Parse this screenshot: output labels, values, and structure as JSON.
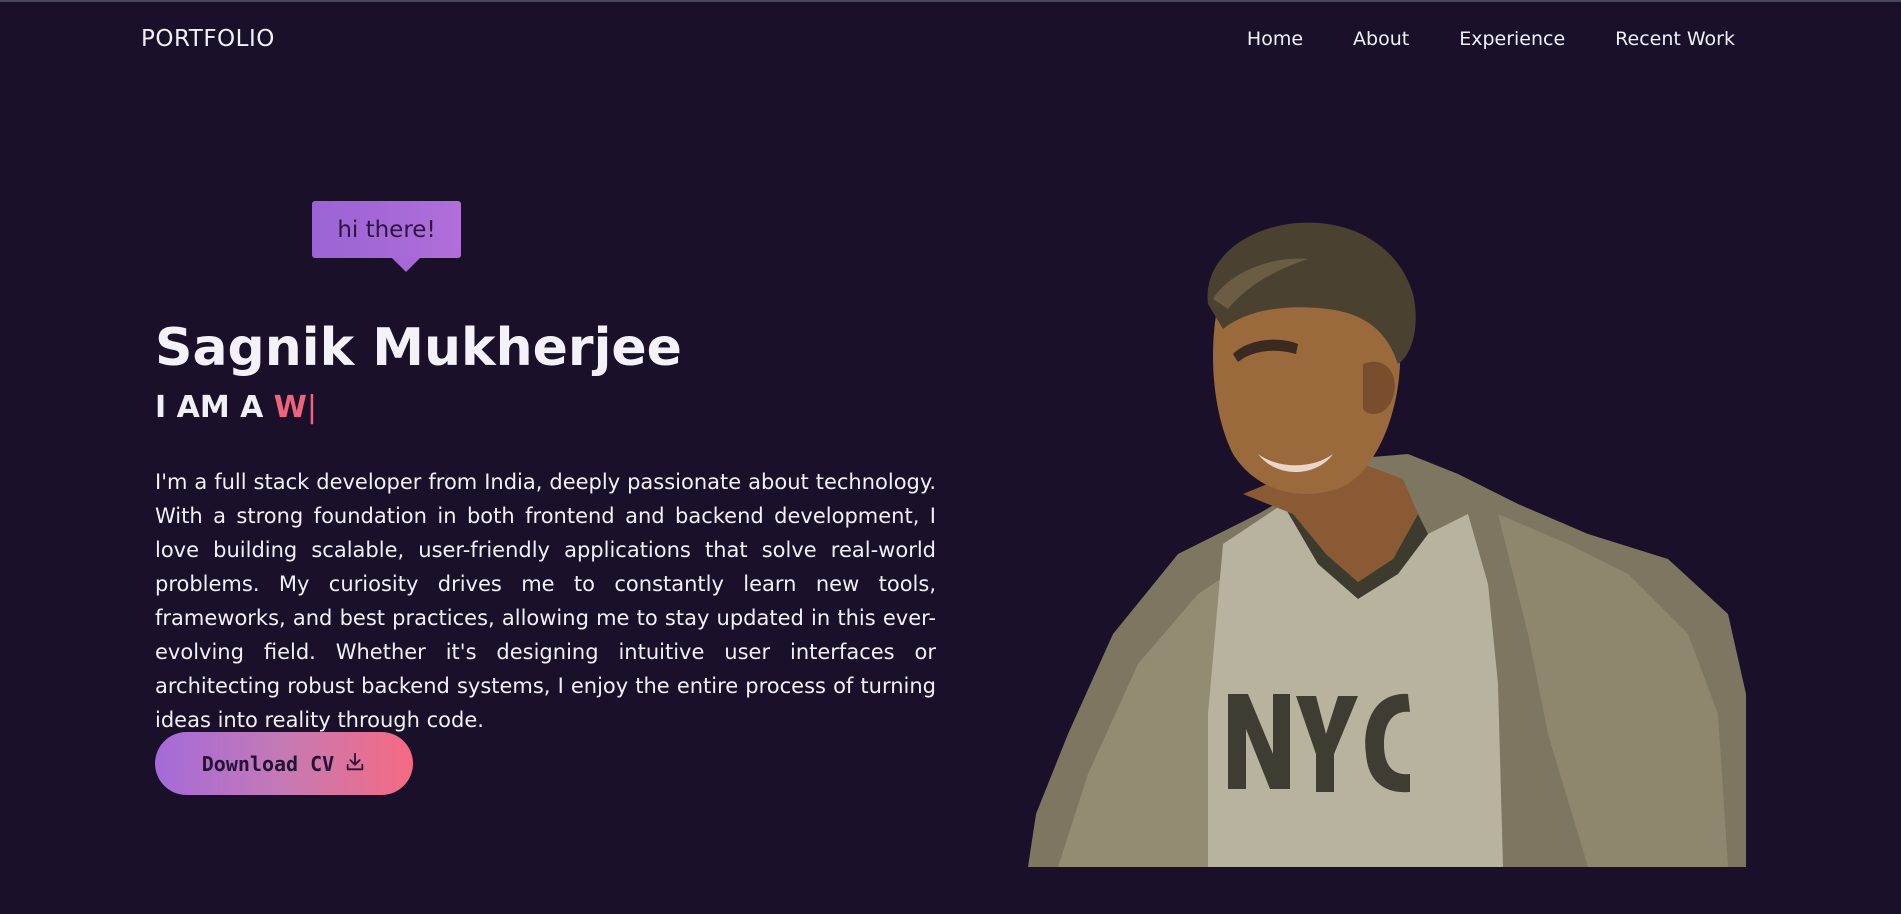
{
  "nav": {
    "logo": "PORTFOLIO",
    "links": [
      "Home",
      "About",
      "Experience",
      "Recent Work"
    ]
  },
  "hero": {
    "greeting": "hi there!",
    "name": "Sagnik Mukherjee",
    "role_prefix": "I AM A",
    "role_typed": "W",
    "role_cursor": "|",
    "bio": "I'm a full stack developer from India, deeply passionate about technology. With a strong foundation in both frontend and backend development, I love building scalable, user-friendly applications that solve real-world problems. My curiosity drives me to constantly learn new tools, frameworks, and best practices, allowing me to stay updated in this ever-evolving field. Whether it's designing intuitive user interfaces or architecting robust backend systems, I enjoy the entire process of turning ideas into reality through code.",
    "cv_button": "Download CV",
    "cv_icon": "download-icon",
    "photo_text": "NYC"
  },
  "colors": {
    "background": "#1a1029",
    "accent_purple": "#a46ad9",
    "accent_pink": "#f0637d"
  }
}
